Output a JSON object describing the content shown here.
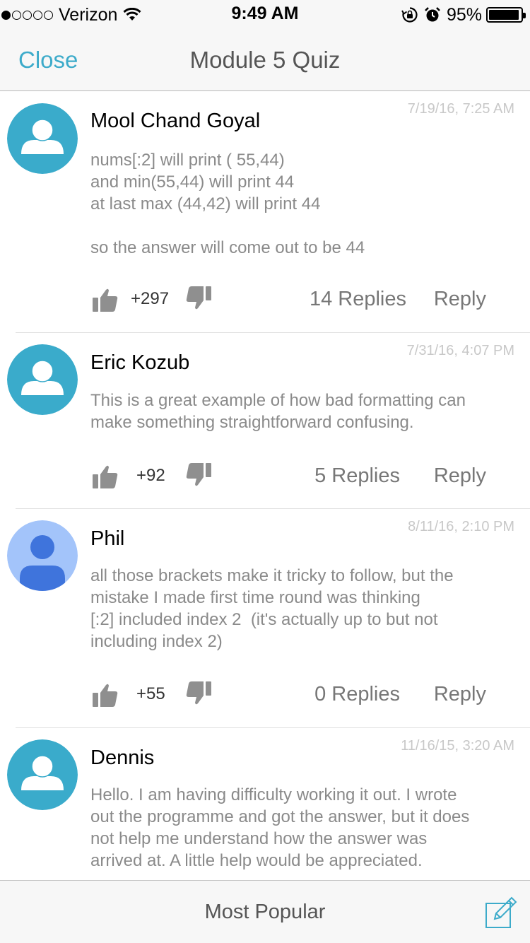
{
  "status_bar": {
    "carrier": "Verizon",
    "signal_dots_filled": 1,
    "signal_dots_total": 5,
    "time": "9:49 AM",
    "battery": "95%",
    "battery_level": 0.95,
    "icons": [
      "wifi-icon",
      "rotation-lock-icon",
      "alarm-icon",
      "battery-icon"
    ]
  },
  "nav": {
    "close_label": "Close",
    "title": "Module 5 Quiz"
  },
  "comments": [
    {
      "author": "Mool Chand Goyal",
      "date": "7/19/16, 7:25 AM",
      "avatar_color": "#3aabcb",
      "text": "nums[:2] will print ( 55,44)\nand min(55,44) will print 44\nat last max (44,42) will print 44\n\nso the answer will come out to be 44",
      "score": "+297",
      "replies": "14 Replies",
      "reply_label": "Reply"
    },
    {
      "author": "Eric Kozub",
      "date": "7/31/16, 4:07 PM",
      "avatar_color": "#3aabcb",
      "text": "This is a great example of how bad formatting can\nmake something straightforward confusing.",
      "score": "+92",
      "replies": "5 Replies",
      "reply_label": "Reply"
    },
    {
      "author": "Phil",
      "date": "8/11/16, 2:10 PM",
      "avatar_color": "#a3c4fa",
      "text": "all those brackets make it tricky to follow, but the\nmistake I made first time round was thinking\n[:2] included index 2  (it's actually up to but not\nincluding index 2)",
      "score": "+55",
      "replies": "0 Replies",
      "reply_label": "Reply"
    },
    {
      "author": "Dennis",
      "date": "11/16/15, 3:20 AM",
      "avatar_color": "#3aabcb",
      "text": "Hello. I am having difficulty working it out. I wrote\nout the programme and got the answer, but it does\nnot help me understand how the answer was\narrived at. A little help would be appreciated."
    }
  ],
  "bottom_bar": {
    "sort_label": "Most Popular"
  },
  "colors": {
    "accent": "#3dabca",
    "date_gray": "#c8c8c8",
    "body_gray": "#8a8a8a"
  }
}
